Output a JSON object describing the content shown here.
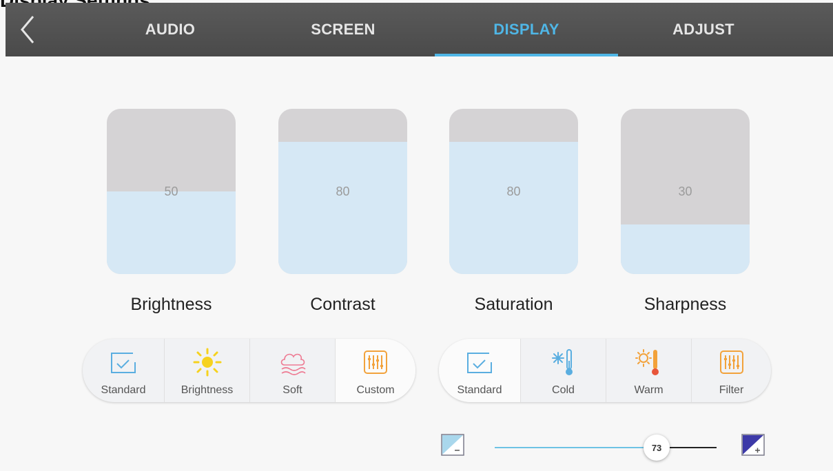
{
  "page_title": "Display Settings",
  "tabs": [
    {
      "label": "AUDIO"
    },
    {
      "label": "SCREEN"
    },
    {
      "label": "DISPLAY",
      "active": true
    },
    {
      "label": "ADJUST"
    }
  ],
  "levels": [
    {
      "label": "Brightness",
      "value": "50",
      "fraction": 0.5
    },
    {
      "label": "Contrast",
      "value": "80",
      "fraction": 0.8
    },
    {
      "label": "Saturation",
      "value": "80",
      "fraction": 0.8
    },
    {
      "label": "Sharpness",
      "value": "30",
      "fraction": 0.3
    }
  ],
  "picture_modes": [
    {
      "label": "Standard",
      "icon": "standard-icon"
    },
    {
      "label": "Brightness",
      "icon": "sun-icon"
    },
    {
      "label": "Soft",
      "icon": "cloud-icon"
    },
    {
      "label": "Custom",
      "icon": "custom-icon",
      "selected": true
    }
  ],
  "color_temps": [
    {
      "label": "Standard",
      "icon": "standard-icon",
      "selected": true
    },
    {
      "label": "Cold",
      "icon": "snowflake-thermometer-icon"
    },
    {
      "label": "Warm",
      "icon": "sun-thermometer-icon"
    },
    {
      "label": "Filter",
      "icon": "filter-icon"
    }
  ],
  "slider": {
    "value": "73",
    "fraction": 0.73
  },
  "colors": {
    "accent": "#4fb6e6",
    "fill": "#d6e8f5",
    "empty": "#d5d3d5"
  }
}
